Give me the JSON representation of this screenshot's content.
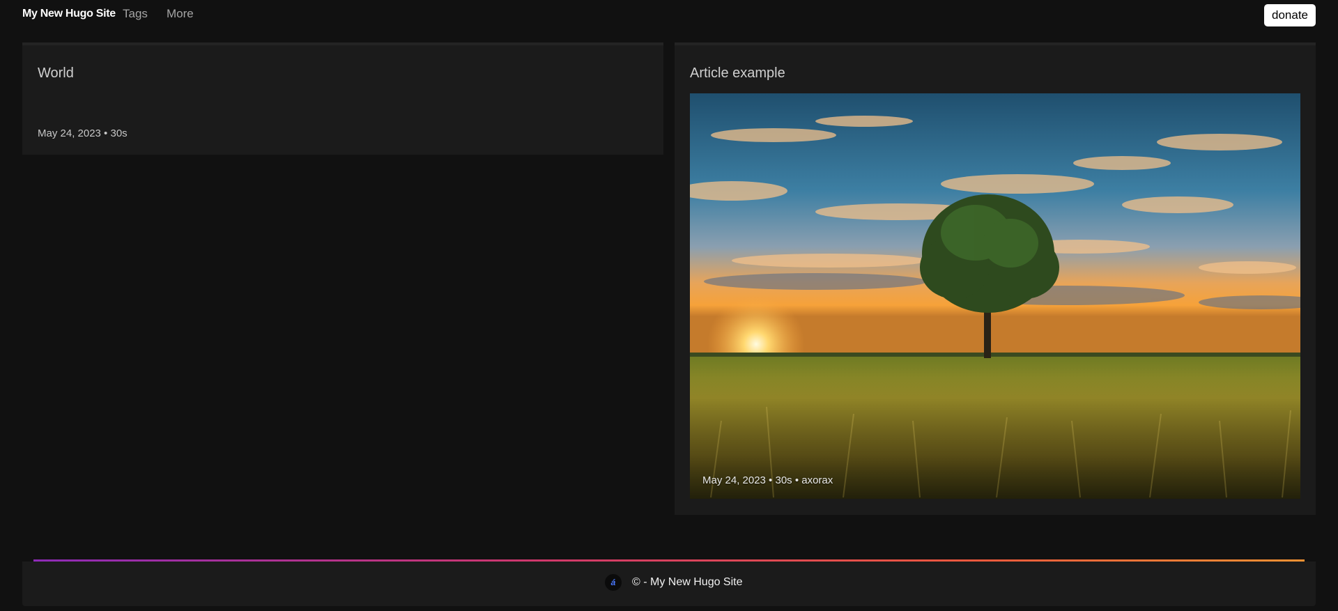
{
  "header": {
    "site_title": "My New Hugo Site",
    "nav": [
      {
        "label": "Tags"
      },
      {
        "label": "More"
      }
    ],
    "donate_label": "donate"
  },
  "posts": [
    {
      "title": "World",
      "meta": "May 24, 2023 • 30s"
    },
    {
      "title": "Article example",
      "meta": "May 24, 2023 • 30s • axorax",
      "image": "sunset-tree-field-photo"
    }
  ],
  "footer": {
    "text": "© - My New Hugo Site",
    "logo_icon": "site-logo-icon"
  },
  "colors": {
    "background": "#111111",
    "card": "#1b1b1b",
    "gradient": [
      "#8e2bb8",
      "#d0386b",
      "#ee5a3c",
      "#f39233"
    ]
  }
}
